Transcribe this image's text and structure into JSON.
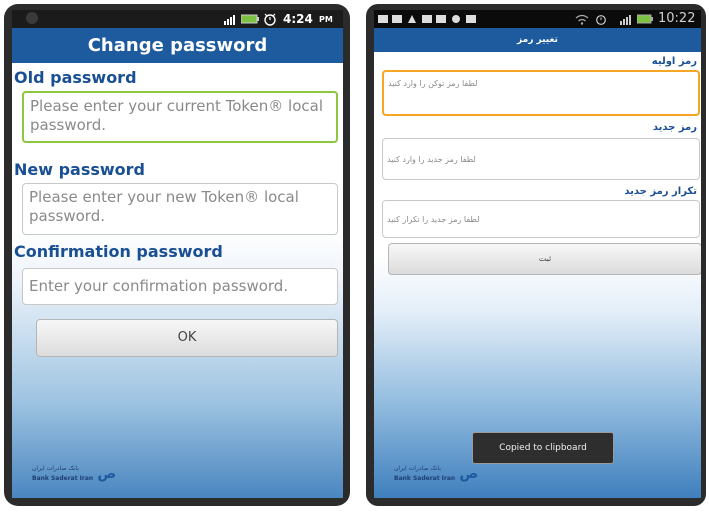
{
  "left": {
    "status": {
      "time": "4:24",
      "ampm": "PM"
    },
    "title": "Change password",
    "old_label": "Old password",
    "old_placeholder": "Please enter your current Token® local password.",
    "new_label": "New password",
    "new_placeholder": "Please enter your new Token® local password.",
    "confirm_label": "Confirmation password",
    "confirm_placeholder": "Enter your confirmation password.",
    "ok_label": "OK",
    "logo_text_fa": "بانک صادرات ایران",
    "logo_text_en": "Bank Saderat Iran",
    "logo_mark": "ص"
  },
  "right": {
    "status": {
      "time": "10:22"
    },
    "title": "تغییر رمز",
    "old_label": "رمز اولیه",
    "old_placeholder": "لطفا رمز توکن را وارد کنید",
    "new_label": "رمز جدید",
    "new_placeholder": "لطفا رمز جدید را وارد کنید",
    "confirm_label": "تکرار رمز جدید",
    "confirm_placeholder": "لطفا رمز جدید را تکرار کنید",
    "ok_label": "ثبت",
    "toast": "Copied to clipboard",
    "logo_text_fa": "بانک صادرات ایران",
    "logo_text_en": "Bank Saderat Iran",
    "logo_mark": "ص"
  },
  "colors": {
    "title_bar": "#1d5a9e",
    "label": "#1a4f94",
    "focus_border_left": "#8dc63f",
    "focus_border_right": "#f5a623",
    "battery": "#7dc242"
  },
  "icons": [
    "signal-icon",
    "battery-icon",
    "alarm-icon",
    "notification-icons",
    "wifi-icon",
    "bank-logo-icon"
  ]
}
